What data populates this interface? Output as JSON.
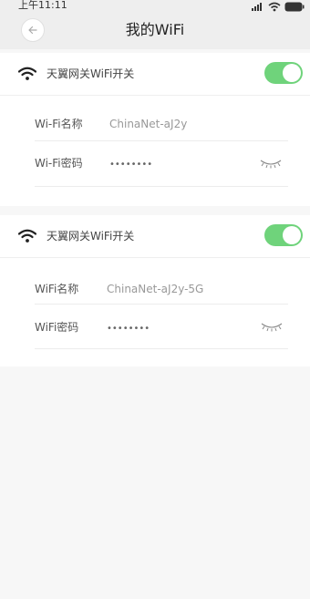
{
  "status_bar": {
    "time": "上午11:11",
    "icons": [
      "signal-icon",
      "wifi-icon",
      "battery-icon"
    ]
  },
  "nav": {
    "title": "我的WiFi",
    "back_icon": "back-arrow-icon"
  },
  "networks": [
    {
      "switch_label": "天翼网关WiFi开关",
      "switch_on": true,
      "name_label": "Wi-Fi名称",
      "name_value": "ChinaNet-aJ2y",
      "password_label": "Wi-Fi密码",
      "password_value": "••••••••"
    },
    {
      "switch_label": "天翼网关WiFi开关",
      "switch_on": true,
      "name_label": "WiFi名称",
      "name_value": "ChinaNet-aJ2y-5G",
      "password_label": "WiFi密码",
      "password_value": "••••••••"
    }
  ],
  "colors": {
    "toggle_on": "#6fd37b",
    "nav_bg": "#eeeeee",
    "page_bg": "#f7f7f7"
  }
}
